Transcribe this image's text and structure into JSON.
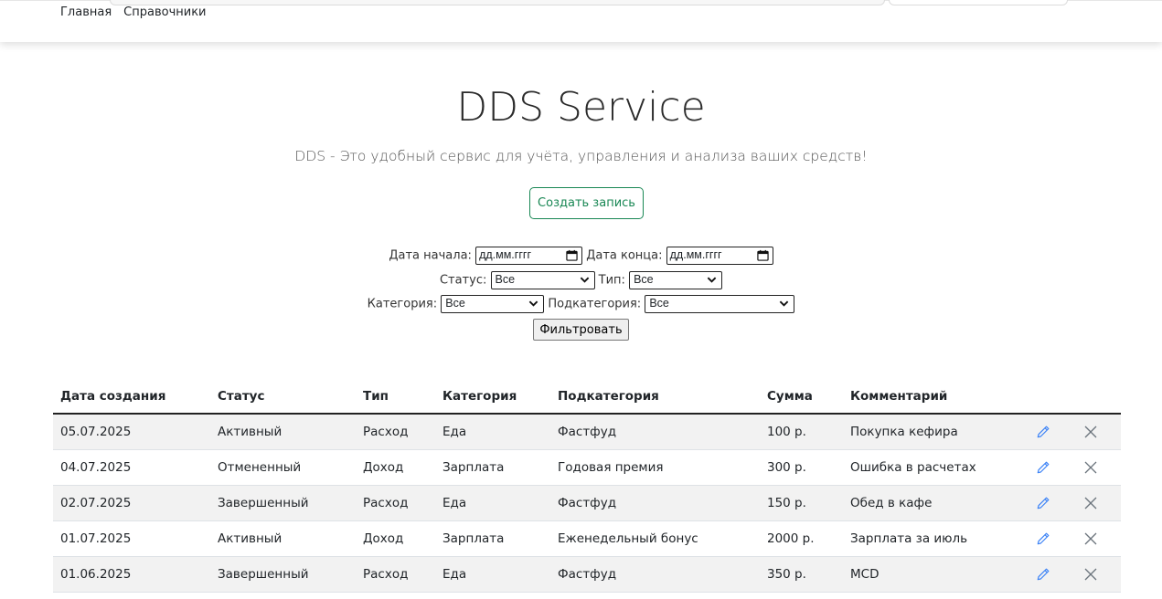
{
  "nav": {
    "home": "Главная",
    "references": "Справочники"
  },
  "hero": {
    "title": "DDS Service",
    "subtitle": "DDS - Это удобный сервис для учёта, управления и анализа ваших средств!",
    "create_button": "Создать запись"
  },
  "filters": {
    "date_from_label": "Дата начала:",
    "date_from_value": "дд.мм.гггг",
    "date_to_label": "Дата конца:",
    "date_to_value": "дд.мм.гггг",
    "status_label": "Статус:",
    "status_value": "Все",
    "type_label": "Тип:",
    "type_value": "Все",
    "category_label": "Категория:",
    "category_value": "Все",
    "subcategory_label": "Подкатегория:",
    "subcategory_value": "Все",
    "filter_button": "Фильтровать"
  },
  "table": {
    "headers": [
      "Дата создания",
      "Статус",
      "Тип",
      "Категория",
      "Подкатегория",
      "Сумма",
      "Комментарий"
    ],
    "rows": [
      [
        "05.07.2025",
        "Активный",
        "Расход",
        "Еда",
        "Фастфуд",
        "100 р.",
        "Покупка кефира"
      ],
      [
        "04.07.2025",
        "Отмененный",
        "Доход",
        "Зарплата",
        "Годовая премия",
        "300 р.",
        "Ошибка в расчетах"
      ],
      [
        "02.07.2025",
        "Завершенный",
        "Расход",
        "Еда",
        "Фастфуд",
        "150 р.",
        "Обед в кафе"
      ],
      [
        "01.07.2025",
        "Активный",
        "Доход",
        "Зарплата",
        "Еженедельный бонус",
        "2000 р.",
        "Зарплата за июль"
      ],
      [
        "01.06.2025",
        "Завершенный",
        "Расход",
        "Еда",
        "Фастфуд",
        "350 р.",
        "MCD"
      ]
    ]
  },
  "colors": {
    "accent_green": "#198754",
    "edit_icon": "#3b82f6",
    "delete_icon": "#6c757d"
  },
  "icons": {
    "edit": "pencil-icon",
    "delete": "close-icon",
    "calendar": "calendar-icon",
    "dropdown": "chevron-down-icon"
  }
}
